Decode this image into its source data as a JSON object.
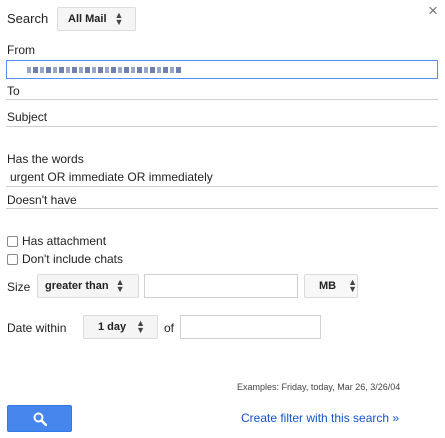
{
  "search": {
    "label": "Search",
    "scope_value": "All Mail"
  },
  "close_glyph": "×",
  "from": {
    "label": "From",
    "value_redacted": true
  },
  "to": {
    "label": "To",
    "value": ""
  },
  "subject": {
    "label": "Subject",
    "value": ""
  },
  "has_words": {
    "label": "Has the words",
    "value": "urgent OR immediate OR immediately"
  },
  "doesnt_have": {
    "label": "Doesn't have",
    "value": ""
  },
  "has_attachment": {
    "label": "Has attachment",
    "checked": false
  },
  "dont_include_chats": {
    "label": "Don't include chats",
    "checked": false
  },
  "size": {
    "label": "Size",
    "operator": "greater than",
    "value": "",
    "unit": "MB"
  },
  "date_within": {
    "label": "Date within",
    "value": "1 day",
    "of_label": "of",
    "of_value": ""
  },
  "examples": "Examples: Friday, today, Mar 26, 3/26/04",
  "create_filter_link": "Create filter with this search »",
  "colors": {
    "accent_blue": "#4787ed",
    "focus_border": "#4d90fe",
    "link": "#1155cc"
  },
  "icons": {
    "search_button": "search-icon",
    "close": "close-icon"
  }
}
